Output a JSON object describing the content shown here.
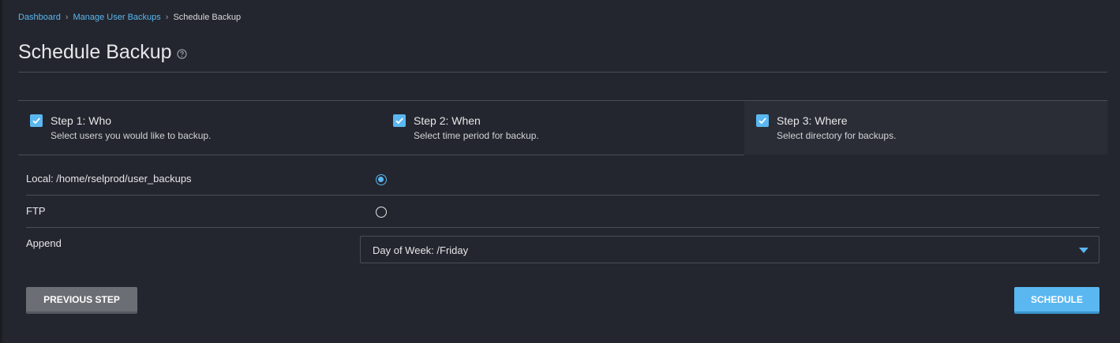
{
  "breadcrumb": {
    "items": [
      "Dashboard",
      "Manage User Backups"
    ],
    "current": "Schedule Backup"
  },
  "page": {
    "title": "Schedule Backup",
    "help_icon": "question-circle-icon"
  },
  "steps": [
    {
      "title": "Step 1: Who",
      "description": "Select users you would like to backup.",
      "checked": true
    },
    {
      "title": "Step 2: When",
      "description": "Select time period for backup.",
      "checked": true
    },
    {
      "title": "Step 3: Where",
      "description": "Select directory for backups.",
      "checked": true,
      "active": true
    }
  ],
  "destination": {
    "local_label": "Local: /home/rselprod/user_backups",
    "local_selected": true,
    "ftp_label": "FTP",
    "ftp_selected": false
  },
  "append": {
    "label": "Append",
    "value": "Day of Week: /Friday"
  },
  "buttons": {
    "previous": "PREVIOUS STEP",
    "schedule": "SCHEDULE"
  },
  "colors": {
    "accent": "#5ab7f0",
    "background": "#23262e",
    "active_step_bg": "#2a2d36",
    "secondary_button": "#6b6e74"
  }
}
